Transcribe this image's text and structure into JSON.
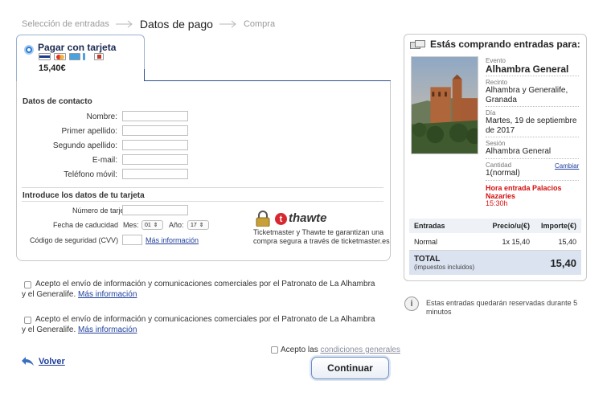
{
  "steps": [
    {
      "label": "Selección de entradas",
      "state": "done"
    },
    {
      "label": "Datos de pago",
      "state": "active"
    },
    {
      "label": "Compra",
      "state": "pending"
    }
  ],
  "payment": {
    "method_label": "Pagar con tarjeta",
    "price": "15,40€",
    "cards": [
      "visa-icon",
      "mastercard-icon",
      "card-icon",
      "card-alt-icon"
    ]
  },
  "contact": {
    "title": "Datos de contacto",
    "fields": {
      "nombre": "Nombre:",
      "apellido1": "Primer apellido:",
      "apellido2": "Segundo apellido:",
      "email": "E-mail:",
      "telefono": "Teléfono móvil:"
    }
  },
  "card": {
    "title": "Introduce los datos de tu tarjeta",
    "number_label": "Número de tarjeta",
    "expiry_label": "Fecha de caducidad",
    "month_label": "Mes:",
    "month_value": "01",
    "year_label": "Año:",
    "year_value": "17",
    "cvv_label": "Código de seguridad (CVV)",
    "more_info": "Más información"
  },
  "thawte": {
    "brand": "thawte",
    "logo_letter": "t",
    "text": "Ticketmaster y Thawte te garantizan una compra segura a través de ticketmaster.es"
  },
  "consents": [
    {
      "text": "Acepto el envío de información y comunicaciones comerciales por el Patronato de La Alhambra y el Generalife.",
      "link": "Más información"
    },
    {
      "text": "Acepto el envío de información y comunicaciones comerciales por el Patronato de La Alhambra y el Generalife.",
      "link": "Más información"
    }
  ],
  "terms": {
    "prefix": "Acepto las",
    "link": "condiciones generales"
  },
  "actions": {
    "back": "Volver",
    "continue": "Continuar"
  },
  "summary": {
    "title": "Estás comprando entradas para:",
    "evento_label": "Evento",
    "evento": "Alhambra General",
    "recinto_label": "Recinto",
    "recinto": "Alhambra y Generalife, Granada",
    "dia_label": "Día",
    "dia": "Martes, 19 de septiembre de 2017",
    "sesion_label": "Sesión",
    "sesion": "Alhambra General",
    "cantidad_label": "Cantidad",
    "cantidad": "1(normal)",
    "cambiar": "Cambiar",
    "hora_label": "Hora entrada Palacios Nazaries",
    "hora": "15:30h",
    "table": {
      "col_entradas": "Entradas",
      "col_precio": "Precio/u(€)",
      "col_importe": "Importe(€)",
      "row_type": "Normal",
      "row_precio": "1x 15,40",
      "row_importe": "15,40",
      "total_label": "TOTAL",
      "total_sub": "(impuestos incluidos)",
      "total_value": "15,40"
    }
  },
  "hold_note": "Estas entradas quedarán reservadas durante 5 minutos",
  "colors": {
    "accent": "#2a7cd6",
    "link": "#1f3f9c",
    "warning": "#d40f0f",
    "total_bg": "#dbe3f1"
  }
}
